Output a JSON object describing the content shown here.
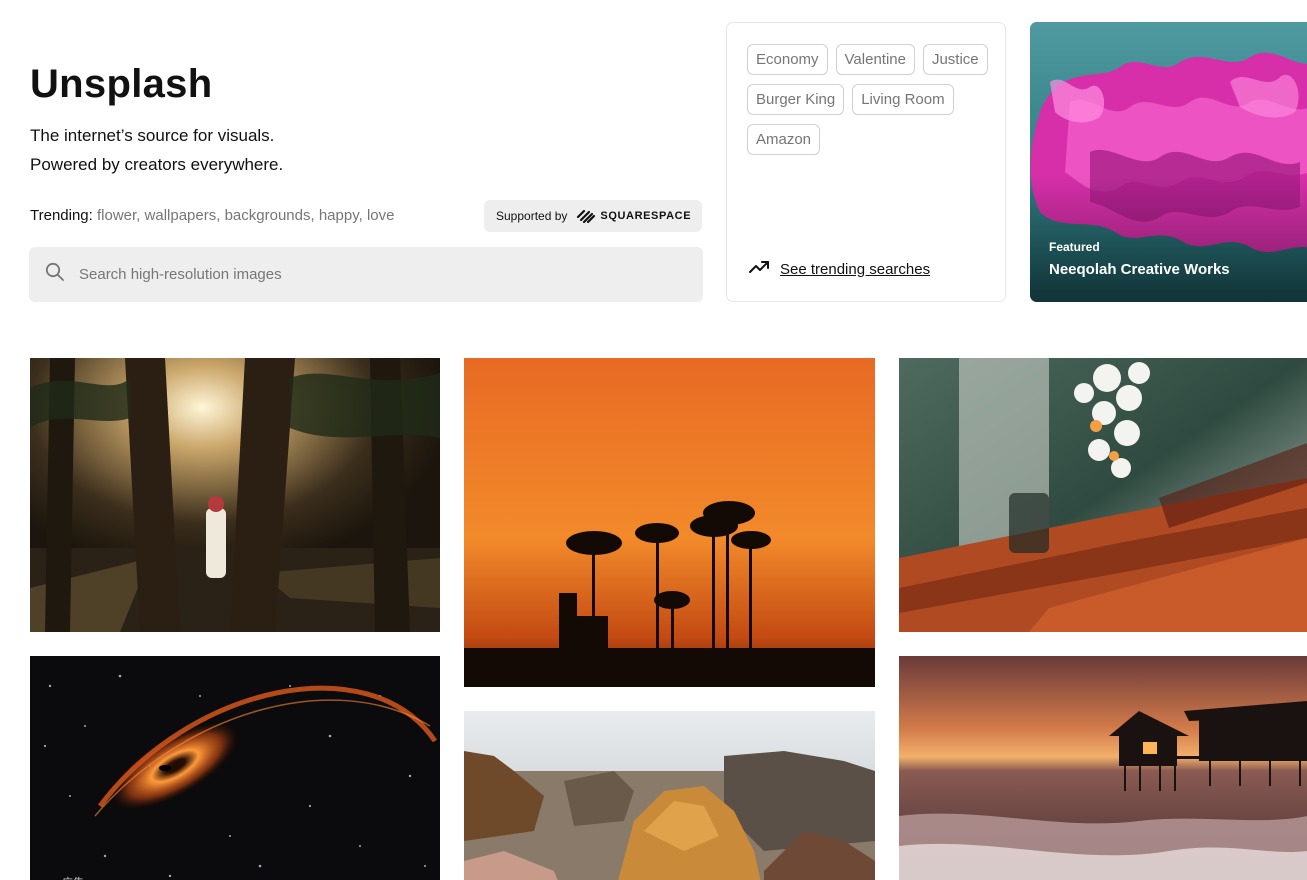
{
  "hero": {
    "title": "Unsplash",
    "subtitle_line1": "The internet’s source for visuals.",
    "subtitle_line2": "Powered by creators everywhere.",
    "trending_label": "Trending:",
    "trending_items": [
      "flower",
      "wallpapers",
      "backgrounds",
      "happy",
      "love"
    ],
    "sponsor_label": "Supported by",
    "sponsor_brand": "SQUARESPACE"
  },
  "search": {
    "placeholder": "Search high-resolution images",
    "value": ""
  },
  "trending_card": {
    "chips": [
      "Economy",
      "Valentine",
      "Justice",
      "Burger King",
      "Living Room",
      "Amazon"
    ],
    "see_trending": "See trending searches"
  },
  "featured": {
    "label": "Featured",
    "name": "Neeqolah Creative Works"
  },
  "photos": [
    {
      "subject": "palm-grove-person"
    },
    {
      "subject": "orange-sunset-palms"
    },
    {
      "subject": "vintage-radio-flowers"
    },
    {
      "subject": "galaxy-black-hole"
    },
    {
      "subject": "desert-rock-formations"
    },
    {
      "subject": "ocean-sunset-bungalow"
    }
  ],
  "ad_tag": "广告",
  "colors": {
    "search_bg": "#eeeeee",
    "muted_text": "#767676",
    "chip_border": "#d1d1d1",
    "featured_bg": "#3c8a8f",
    "flower_magenta": "#d62fa9"
  }
}
